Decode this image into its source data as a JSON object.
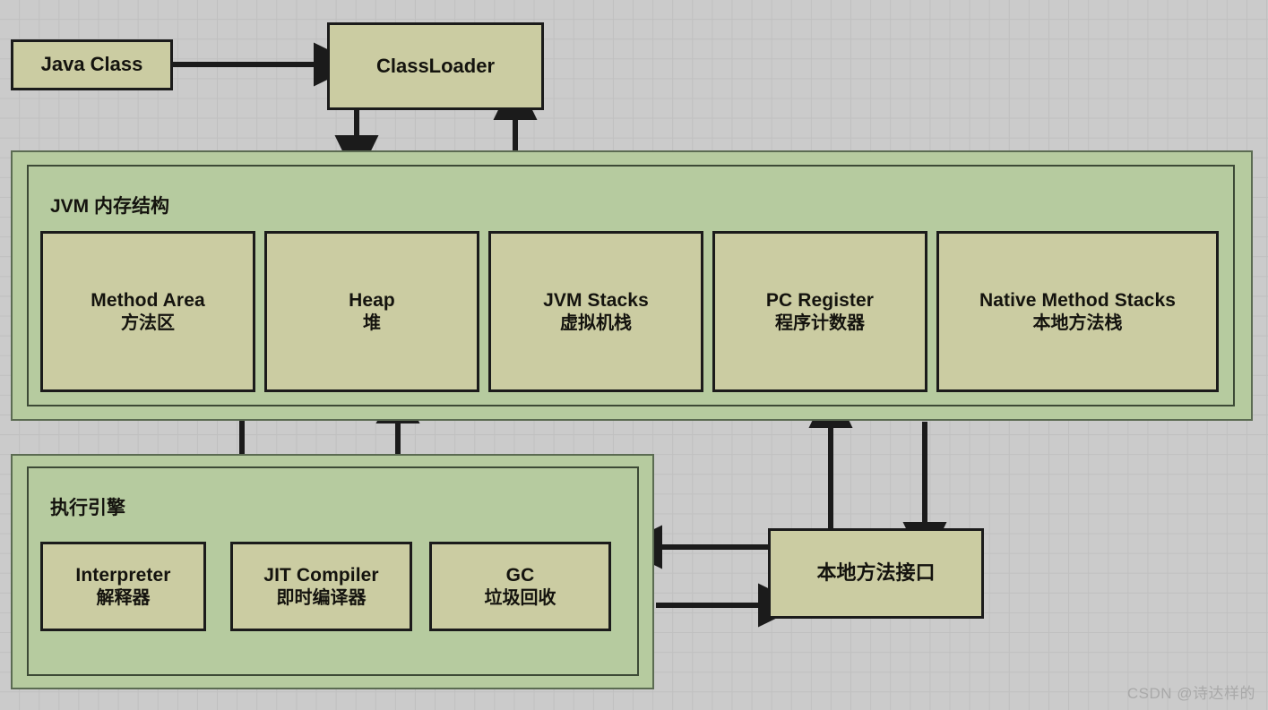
{
  "diagram": {
    "title": "JVM Architecture Diagram",
    "background_color": "#cbcbcb",
    "grid_line_color": "#c0c0c0",
    "node_fill_color": "#cbcca2",
    "node_border_color": "#1b1b1b",
    "container_fill_color": "#b6cb9f",
    "arrow_color": "#1b1b1b"
  },
  "nodes": {
    "java_class": {
      "label": "Java Class"
    },
    "class_loader": {
      "label": "ClassLoader"
    },
    "native_method_interface": {
      "label": "本地方法接口"
    }
  },
  "memory_structure": {
    "title": "JVM 内存结构",
    "areas": [
      {
        "en": "Method Area",
        "cn": "方法区"
      },
      {
        "en": "Heap",
        "cn": "堆"
      },
      {
        "en": "JVM Stacks",
        "cn": "虚拟机栈"
      },
      {
        "en": "PC Register",
        "cn": "程序计数器"
      },
      {
        "en": "Native Method Stacks",
        "cn": "本地方法栈"
      }
    ]
  },
  "execution_engine": {
    "title": "执行引擎",
    "components": [
      {
        "en": "Interpreter",
        "cn": "解释器"
      },
      {
        "en": "JIT Compiler",
        "cn": "即时编译器"
      },
      {
        "en": "GC",
        "cn": "垃圾回收"
      }
    ]
  },
  "watermark": {
    "text": "CSDN @诗达样的"
  },
  "connections": [
    {
      "from": "java_class",
      "to": "class_loader",
      "direction": "right"
    },
    {
      "from": "class_loader",
      "to": "memory_structure",
      "direction": "down"
    },
    {
      "from": "memory_structure",
      "to": "class_loader",
      "direction": "up"
    },
    {
      "from": "memory_structure",
      "to": "execution_engine",
      "direction": "down"
    },
    {
      "from": "execution_engine",
      "to": "memory_structure",
      "direction": "up"
    },
    {
      "from": "native_method_interface",
      "to": "memory_structure",
      "direction": "up"
    },
    {
      "from": "memory_structure",
      "to": "native_method_interface",
      "direction": "down"
    },
    {
      "from": "native_method_interface",
      "to": "execution_engine",
      "direction": "left"
    },
    {
      "from": "execution_engine",
      "to": "native_method_interface",
      "direction": "right"
    }
  ]
}
